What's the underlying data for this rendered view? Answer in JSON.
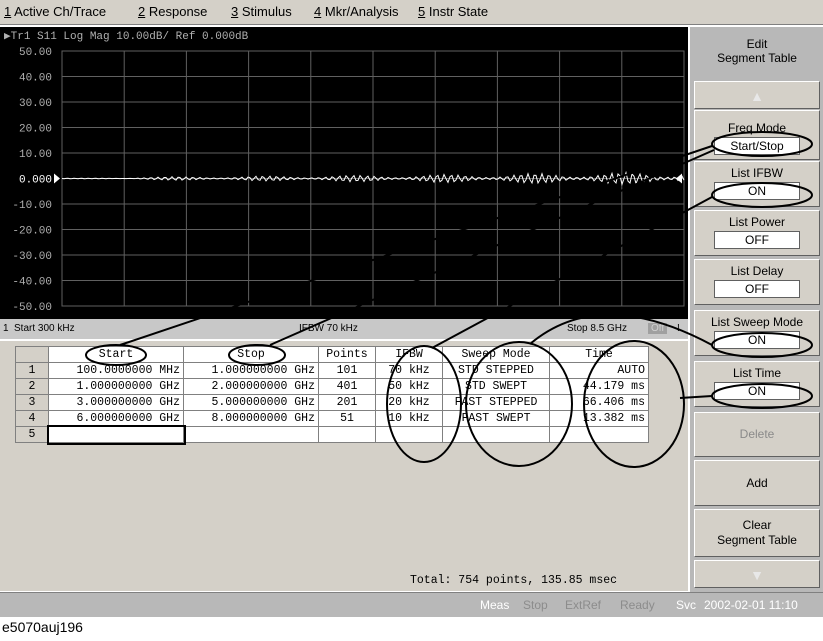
{
  "menu": [
    {
      "key": "1",
      "label": "Active Ch/Trace"
    },
    {
      "key": "2",
      "label": "Response"
    },
    {
      "key": "3",
      "label": "Stimulus"
    },
    {
      "key": "4",
      "label": "Mkr/Analysis"
    },
    {
      "key": "5",
      "label": "Instr State"
    }
  ],
  "trace": {
    "header": "▶Tr1  S11  Log Mag  10.00dB/  Ref  0.000dB",
    "y_labels": [
      "50.00",
      "40.00",
      "30.00",
      "20.00",
      "10.00",
      "0.000",
      "-10.00",
      "-20.00",
      "-30.00",
      "-40.00",
      "-50.00"
    ],
    "ref_label": "0.000",
    "colors": {
      "trace": "#ffffff",
      "grid": "#606060",
      "text": "#b0b0b0",
      "background": "#000000"
    }
  },
  "status": {
    "channel": "1",
    "start": "Start 300 kHz",
    "ifbw": "IFBW 70 kHz",
    "stop": "Stop 8.5 GHz",
    "off": "Off",
    "excl": "!"
  },
  "table": {
    "headers": [
      "Start",
      "Stop",
      "Points",
      "IFBW",
      "Sweep Mode",
      "Time"
    ],
    "rows": [
      {
        "n": "1",
        "start": "100.0000000 MHz",
        "stop": "1.000000000 GHz",
        "points": "101",
        "ifbw": "70 kHz",
        "mode": "STD STEPPED",
        "time": "AUTO"
      },
      {
        "n": "2",
        "start": "1.000000000 GHz",
        "stop": "2.000000000 GHz",
        "points": "401",
        "ifbw": "50 kHz",
        "mode": "STD SWEPT",
        "time": "44.179 ms"
      },
      {
        "n": "3",
        "start": "3.000000000 GHz",
        "stop": "5.000000000 GHz",
        "points": "201",
        "ifbw": "20 kHz",
        "mode": "FAST STEPPED",
        "time": "66.406 ms"
      },
      {
        "n": "4",
        "start": "6.000000000 GHz",
        "stop": "8.000000000 GHz",
        "points": "51",
        "ifbw": "10 kHz",
        "mode": "FAST SWEPT",
        "time": "13.382 ms"
      },
      {
        "n": "5",
        "start": "",
        "stop": "",
        "points": "",
        "ifbw": "",
        "mode": "",
        "time": ""
      }
    ],
    "total": "Total: 754 points, 135.85 msec"
  },
  "softkeys": {
    "title": "Edit\nSegment Table",
    "freq_mode": {
      "label": "Freq Mode",
      "value": "Start/Stop"
    },
    "list_ifbw": {
      "label": "List IFBW",
      "value": "ON"
    },
    "list_power": {
      "label": "List Power",
      "value": "OFF"
    },
    "list_delay": {
      "label": "List Delay",
      "value": "OFF"
    },
    "list_sweep_mode": {
      "label": "List Sweep Mode",
      "value": "ON"
    },
    "list_time": {
      "label": "List Time",
      "value": "ON"
    },
    "delete": "Delete",
    "add": "Add",
    "clear_1": "Clear",
    "clear_2": "Segment Table"
  },
  "bottom": {
    "meas": "Meas",
    "stop": "Stop",
    "extref": "ExtRef",
    "ready": "Ready",
    "svc": "Svc",
    "datetime": "2002-02-01 11:10"
  },
  "caption": "e5070auj196"
}
